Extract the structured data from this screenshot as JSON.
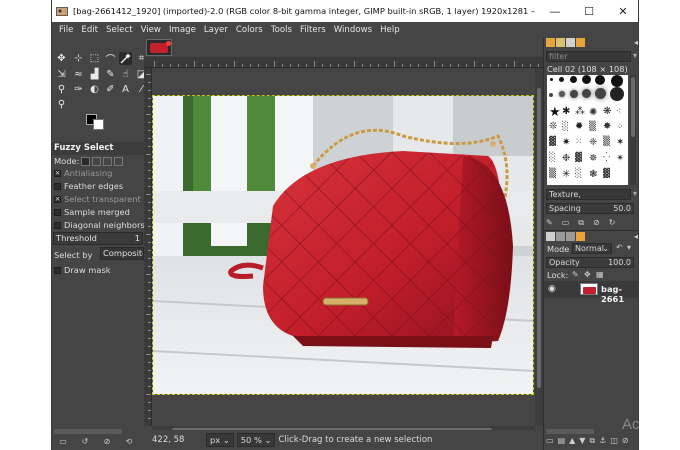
{
  "window": {
    "title": "[bag-2661412_1920] (imported)-2.0 (RGB color 8-bit gamma integer, GIMP built-in sRGB, 1 layer) 1920x1281 – GIMP",
    "minimize_glyph": "—",
    "maximize_glyph": "☐",
    "close_glyph": "✕"
  },
  "menu": [
    "File",
    "Edit",
    "Select",
    "View",
    "Image",
    "Layer",
    "Colors",
    "Tools",
    "Filters",
    "Windows",
    "Help"
  ],
  "tool_options": {
    "title": "Fuzzy Select",
    "mode_label": "Mode:",
    "antialiasing": "Antialiasing",
    "feather_edges": "Feather edges",
    "select_transparent": "Select transparent areas",
    "sample_merged": "Sample merged",
    "diagonal_neighbors": "Diagonal neighbors",
    "threshold_label": "Threshold",
    "threshold_value": "1",
    "select_by_label": "Select by",
    "select_by_value": "Composite",
    "draw_mask": "Draw mask"
  },
  "status": {
    "coords": "422, 58",
    "unit": "px",
    "zoom": "50 %",
    "message": "Click-Drag to create a new selection"
  },
  "brushes": {
    "filter_placeholder": "filter",
    "current_brush": "Cell 02 (108 × 108)",
    "tag_field": "Texture,",
    "spacing_label": "Spacing",
    "spacing_value": "50.0"
  },
  "layers": {
    "mode_label": "Mode",
    "mode_value": "Normal",
    "opacity_label": "Opacity",
    "opacity_value": "100.0",
    "lock_label": "Lock:",
    "layer_name": "bag-2661"
  },
  "watermark": "Ac",
  "colors": {
    "accent_orange": "#e8a33a",
    "window_bg": "#454545",
    "bag_red": "#c41f2c"
  }
}
